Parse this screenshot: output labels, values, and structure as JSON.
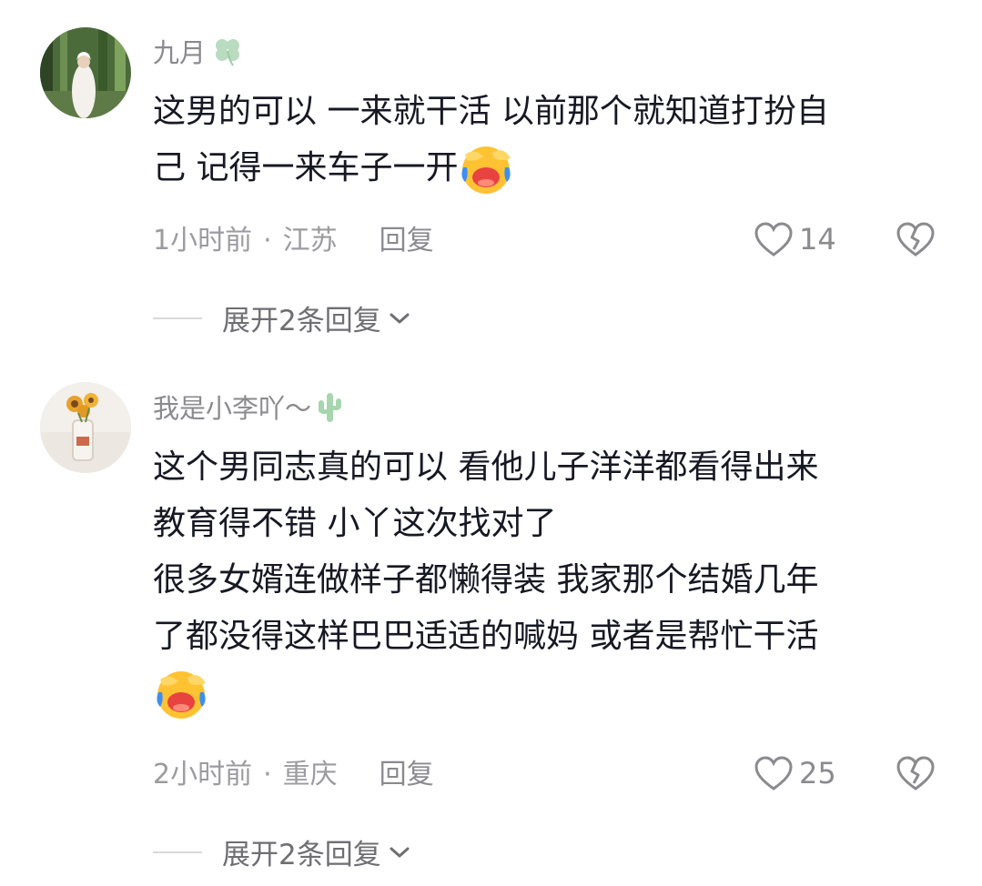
{
  "comments": [
    {
      "username": "九月",
      "username_emoji": "clover-icon",
      "lines": [
        "这男的可以 一来就干活 以前那个就知道打扮自",
        "己 记得一来车子一开"
      ],
      "trailing_emoji": "laughing-crying-emoji",
      "time": "1小时前",
      "dot": "·",
      "location": "江苏",
      "reply_label": "回复",
      "like_count": "14",
      "expand_label": "展开2条回复"
    },
    {
      "username": "我是小李吖～",
      "username_emoji": "cactus-icon",
      "lines": [
        "这个男同志真的可以   看他儿子洋洋都看得出来",
        "教育得不错  小丫这次找对了",
        "很多女婿连做样子都懒得装   我家那个结婚几年",
        "了都没得这样巴巴适适的喊妈 或者是帮忙干活"
      ],
      "trailing_emoji": "laughing-crying-emoji",
      "time": "2小时前",
      "dot": "·",
      "location": "重庆",
      "reply_label": "回复",
      "like_count": "25",
      "expand_label": "展开2条回复"
    }
  ],
  "colors": {
    "text_primary": "#161823",
    "text_secondary": "#8a8a8f",
    "emoji_yellow": "#ffc233",
    "emoji_mouth": "#e8433f",
    "tear_blue": "#3d8ef0"
  }
}
